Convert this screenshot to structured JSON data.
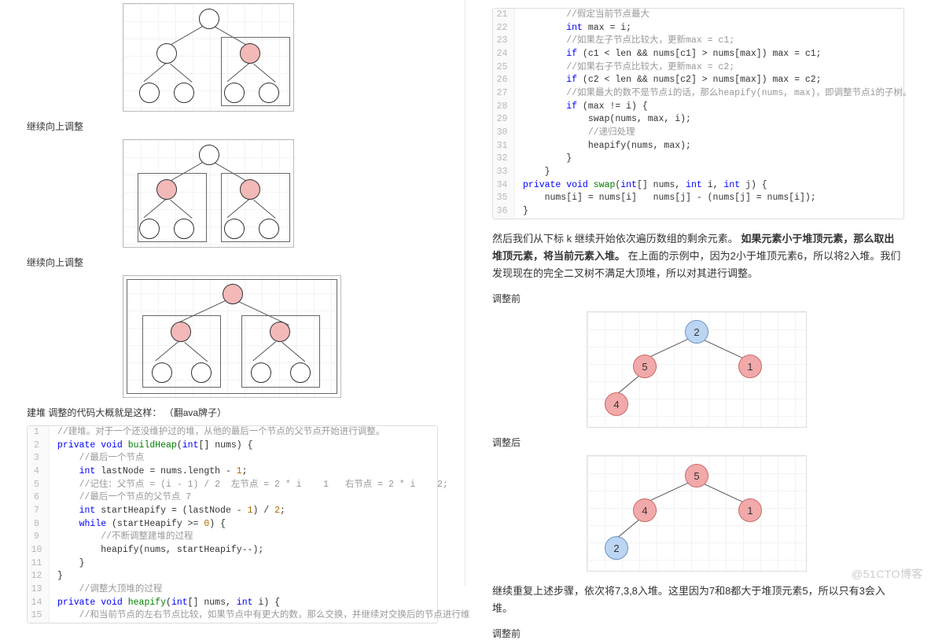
{
  "left": {
    "section1": "继续向上调整",
    "section2": "继续向上调整",
    "section3a": "建堆 调整的代码大概就是这样：",
    "section3b": "（翻ava牌子）",
    "code": [
      {
        "n": 1,
        "h": "<span class='c-cmt'>//建堆。对于一个还没维护过的堆，从他的最后一个节点的父节点开始进行调整。</span>"
      },
      {
        "n": 2,
        "h": "<span class='c-kw'>private</span> <span class='c-kw'>void</span> <span style='color:#008000'>buildHeap</span>(<span class='c-kw'>int</span>[] nums) {"
      },
      {
        "n": 3,
        "h": "    <span class='c-cmt'>//最后一个节点</span>"
      },
      {
        "n": 4,
        "h": "    <span class='c-kw'>int</span> lastNode = nums.length - <span class='c-num'>1</span>;"
      },
      {
        "n": 5,
        "h": "    <span class='c-cmt'>//记住：父节点 = (i - 1) / 2  左节点 = 2 * i    1   右节点 = 2 * i    2;</span>"
      },
      {
        "n": 6,
        "h": "    <span class='c-cmt'>//最后一个节点的父节点 7</span>"
      },
      {
        "n": 7,
        "h": "    <span class='c-kw'>int</span> startHeapify = (lastNode - <span class='c-num'>1</span>) / <span class='c-num'>2</span>;"
      },
      {
        "n": 8,
        "h": "    <span class='c-kw'>while</span> (startHeapify >= <span class='c-num'>0</span>) {"
      },
      {
        "n": 9,
        "h": "        <span class='c-cmt'>//不断调整建堆的过程</span>"
      },
      {
        "n": 10,
        "h": "        heapify(nums, startHeapify--);"
      },
      {
        "n": 11,
        "h": "    }"
      },
      {
        "n": 12,
        "h": "}"
      },
      {
        "n": 13,
        "h": "    <span class='c-cmt'>//调整大顶堆的过程</span>"
      },
      {
        "n": 14,
        "h": "<span class='c-kw'>private</span> <span class='c-kw'>void</span> <span style='color:#008000'>heapify</span>(<span class='c-kw'>int</span>[] nums, <span class='c-kw'>int</span> i) {"
      },
      {
        "n": 15,
        "h": "    <span class='c-cmt'>//和当前节点的左右节点比较，如果节点中有更大的数，那么交换，并继续对交换后的节点进行维</span>"
      }
    ]
  },
  "right": {
    "code": [
      {
        "n": 21,
        "h": "        <span class='c-cmt'>//假定当前节点最大</span>"
      },
      {
        "n": 22,
        "h": "        <span class='c-kw'>int</span> max = i;"
      },
      {
        "n": 23,
        "h": "        <span class='c-cmt'>//如果左子节点比较大，更新max = c1;</span>"
      },
      {
        "n": 24,
        "h": "        <span class='c-kw'>if</span> (c1 &lt; len &amp;&amp; nums[c1] &gt; nums[max]) max = c1;"
      },
      {
        "n": 25,
        "h": "        <span class='c-cmt'>//如果右子节点比较大，更新max = c2;</span>"
      },
      {
        "n": 26,
        "h": "        <span class='c-kw'>if</span> (c2 &lt; len &amp;&amp; nums[c2] &gt; nums[max]) max = c2;"
      },
      {
        "n": 27,
        "h": "        <span class='c-cmt'>//如果最大的数不是节点i的话，那么heapify(nums, max)，即调整节点i的子树。</span>"
      },
      {
        "n": 28,
        "h": "        <span class='c-kw'>if</span> (max != i) {"
      },
      {
        "n": 29,
        "h": "            swap(nums, max, i);"
      },
      {
        "n": 30,
        "h": "            <span class='c-cmt'>//递归处理</span>"
      },
      {
        "n": 31,
        "h": "            heapify(nums, max);"
      },
      {
        "n": 32,
        "h": "        }"
      },
      {
        "n": 33,
        "h": "    }"
      },
      {
        "n": 34,
        "h": "<span class='c-kw'>private</span> <span class='c-kw'>void</span> <span style='color:#008000'>swap</span>(<span class='c-kw'>int</span>[] nums, <span class='c-kw'>int</span> i, <span class='c-kw'>int</span> j) {"
      },
      {
        "n": 35,
        "h": "    nums[i] = nums[i]   nums[j] - (nums[j] = nums[i]);"
      },
      {
        "n": 36,
        "h": "}"
      }
    ],
    "para1_a": "然后我们从下标 k 继续开始依次遍历数组的剩余元素。",
    "para1_b": "如果元素小于堆顶元素，那么取出堆顶元素，将当前元素入堆。",
    "para1_c": "在上面的示例中，因为2小于堆顶元素6，所以将2入堆。我们发现现在的完全二叉树不满足大顶堆，所以对其进行调整。",
    "before": "调整前",
    "after": "调整后",
    "para2": "继续重复上述步骤，依次将7,3,8入堆。这里因为7和8都大于堆顶元素5，所以只有3会入堆。",
    "before2": "调整前",
    "tree1": {
      "n1": "2",
      "n2": "5",
      "n3": "1",
      "n4": "4"
    },
    "tree2": {
      "n1": "5",
      "n2": "4",
      "n3": "1",
      "n4": "2"
    }
  },
  "chart_data": [
    {
      "type": "tree",
      "title": "Heapify step — right subtree selected",
      "nodes": [
        {
          "id": "r",
          "children": [
            "l",
            "p"
          ],
          "highlight": false
        },
        {
          "id": "l",
          "children": [
            "l1",
            "l2"
          ],
          "highlight": false
        },
        {
          "id": "p",
          "children": [
            "p1",
            "p2"
          ],
          "highlight": true
        },
        {
          "id": "l1"
        },
        {
          "id": "l2"
        },
        {
          "id": "p1"
        },
        {
          "id": "p2"
        }
      ],
      "selection": "right-subtree"
    },
    {
      "type": "tree",
      "title": "Heapify step — both children highlighted",
      "nodes": [
        {
          "id": "r",
          "children": [
            "l",
            "p"
          ],
          "highlight": false
        },
        {
          "id": "l",
          "children": [
            "l1",
            "l2"
          ],
          "highlight": true
        },
        {
          "id": "p",
          "children": [
            "p1",
            "p2"
          ],
          "highlight": true
        },
        {
          "id": "l1"
        },
        {
          "id": "l2"
        },
        {
          "id": "p1"
        },
        {
          "id": "p2"
        }
      ],
      "selection": [
        "left-subtree",
        "right-subtree"
      ]
    },
    {
      "type": "tree",
      "title": "Heapify step — whole heap highlighted",
      "nodes": [
        {
          "id": "r",
          "children": [
            "l",
            "p"
          ],
          "highlight": true
        },
        {
          "id": "l",
          "children": [
            "l1",
            "l2"
          ],
          "highlight": true
        },
        {
          "id": "p",
          "children": [
            "p1",
            "p2"
          ],
          "highlight": true
        },
        {
          "id": "l1"
        },
        {
          "id": "l2"
        },
        {
          "id": "p1"
        },
        {
          "id": "p2"
        }
      ],
      "selection": "root"
    },
    {
      "type": "tree",
      "title": "调整前",
      "nodes": [
        {
          "id": "1",
          "value": 2,
          "color": "blue",
          "children": [
            "2",
            "3"
          ]
        },
        {
          "id": "2",
          "value": 5,
          "color": "red",
          "children": [
            "4"
          ]
        },
        {
          "id": "3",
          "value": 1,
          "color": "red"
        },
        {
          "id": "4",
          "value": 4,
          "color": "red"
        }
      ]
    },
    {
      "type": "tree",
      "title": "调整后",
      "nodes": [
        {
          "id": "1",
          "value": 5,
          "color": "red",
          "children": [
            "2",
            "3"
          ]
        },
        {
          "id": "2",
          "value": 4,
          "color": "red",
          "children": [
            "4"
          ]
        },
        {
          "id": "3",
          "value": 1,
          "color": "red"
        },
        {
          "id": "4",
          "value": 2,
          "color": "blue"
        }
      ]
    }
  ],
  "watermark": "@51CTO博客"
}
